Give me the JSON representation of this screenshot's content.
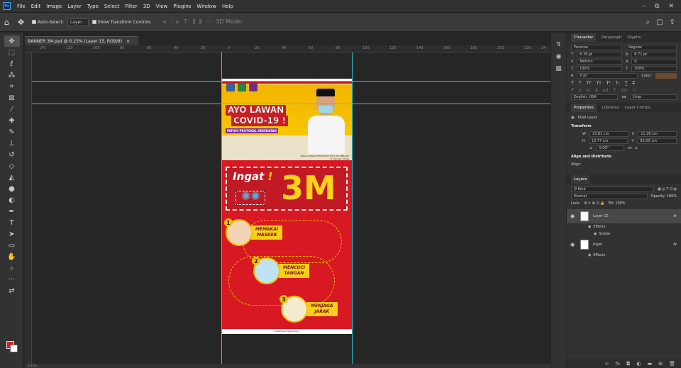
{
  "menubar": {
    "logo": "Ps",
    "items": [
      "File",
      "Edit",
      "Image",
      "Layer",
      "Type",
      "Select",
      "Filter",
      "3D",
      "View",
      "Plugins",
      "Window",
      "Help"
    ],
    "window_controls": [
      "–",
      "⧉",
      "✕"
    ]
  },
  "options": {
    "auto_select_label": "Auto-Select:",
    "auto_select_value": "Layer",
    "show_transform_label": "Show Transform Controls",
    "mode_3d": "3D Mode:",
    "more": "···"
  },
  "document": {
    "tab_title": "BANNER 3M.psd @ 6.25% (Layer 15, RGB/8)",
    "ruler_ticks": [
      "140",
      "120",
      "100",
      "80",
      "60",
      "40",
      "20",
      "0",
      "20",
      "40",
      "60",
      "80",
      "100",
      "120",
      "140",
      "160",
      "180",
      "200",
      "220",
      "24"
    ]
  },
  "banner": {
    "title_line1": "AYO LAWAN",
    "title_line2": "COVID-19 !",
    "subtitle": "PATUHI PROTOKOL KESEHATAN",
    "caption": "KEPALA DINAS KESEHATAN KOTA PALEMBANG",
    "caption2": "dr. Fauziah, M.Kes",
    "ingat": "Ingat",
    "ingat_mark": "!",
    "three_m": "3M",
    "steps": [
      {
        "num": "1",
        "label_1": "MEMAKAI",
        "label_2": "MASKER"
      },
      {
        "num": "2",
        "label_1": "MENCUCI",
        "label_2": "TANGAN"
      },
      {
        "num": "3",
        "label_1": "MENJAGA",
        "label_2": "JARAK"
      }
    ],
    "footer": "Kesehatan Palembang"
  },
  "statusbar": {
    "zoom": "6.25%",
    "dims": "..."
  },
  "panel": {
    "character_tabs": [
      "Character",
      "Paragraph",
      "Glyphs"
    ],
    "font_family": "Proxima",
    "font_style": "Regular",
    "size": "6.78 pt",
    "leading": "8.71 pt",
    "kerning": "Metrics",
    "tracking": "0",
    "vscale": "100%",
    "hscale": "100%",
    "baseline": "0 pt",
    "color_label": "Color:",
    "language": "English: USA",
    "aa": "Crisp",
    "props_tabs": [
      "Properties",
      "Libraries",
      "Layer Comps"
    ],
    "pixel_layer": "Pixel Layer",
    "transform_hdr": "Transform",
    "w": "23.81 cm",
    "x": "11.26 cm",
    "h": "13.77 cm",
    "y": "85.05 cm",
    "angle": "0.00°",
    "align_hdr": "Align and Distribute",
    "align_label": "Align:",
    "layers_tab": "Layers",
    "kind": "Q Kind",
    "blend": "Normal",
    "opacity": "Opacity: 100%",
    "lock": "Lock:",
    "fill": "Fill: 100%",
    "layer_1": "Layer 15",
    "effects": "Effects",
    "stroke": "Stroke",
    "layer_2": "Ingat",
    "effects_2": "Effects",
    "fx": "fx"
  }
}
